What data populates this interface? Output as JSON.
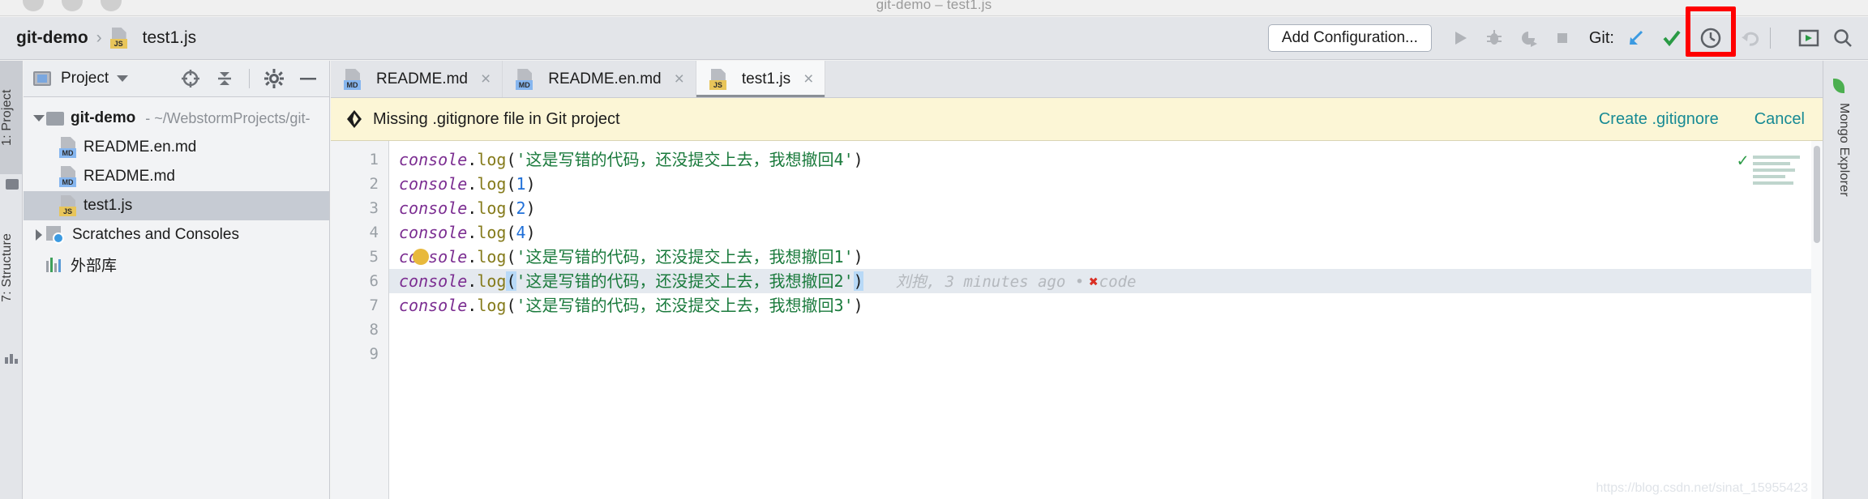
{
  "window": {
    "title": "git-demo – test1.js"
  },
  "breadcrumb": {
    "project": "git-demo",
    "separator": "›",
    "file": "test1.js"
  },
  "toolbar": {
    "add_configuration": "Add Configuration...",
    "git_label": "Git:",
    "icons": [
      "run-icon",
      "debug-icon",
      "run-coverage-icon",
      "stop-icon"
    ],
    "git_icons": [
      "update-project-icon",
      "commit-icon",
      "history-icon",
      "rollback-icon"
    ],
    "right_icons": [
      "terminal-icon",
      "search-everywhere-icon"
    ]
  },
  "left_strip": {
    "tabs": [
      {
        "label": "1: Project",
        "active": true
      },
      {
        "label": "7: Structure",
        "active": false
      }
    ]
  },
  "project_panel": {
    "title": "Project",
    "tools": [
      "locate-icon",
      "collapse-all-icon",
      "settings-gear-icon",
      "hide-icon"
    ],
    "tree": [
      {
        "name": "git-demo",
        "path": "- ~/WebstormProjects/git-",
        "type": "folder",
        "depth": 0,
        "expanded": true,
        "selected": false
      },
      {
        "name": "README.en.md",
        "badge": "MD",
        "type": "file",
        "depth": 1,
        "selected": false
      },
      {
        "name": "README.md",
        "badge": "MD",
        "type": "file",
        "depth": 1,
        "selected": false
      },
      {
        "name": "test1.js",
        "badge": "JS",
        "type": "file",
        "depth": 1,
        "selected": true
      },
      {
        "name": "Scratches and Consoles",
        "type": "scratches",
        "depth": 0,
        "expanded": false,
        "selected": false
      },
      {
        "name": "外部库",
        "type": "library",
        "depth": 0,
        "selected": false
      }
    ]
  },
  "editor": {
    "tabs": [
      {
        "label": "README.md",
        "badge": "MD",
        "active": false,
        "close": "×"
      },
      {
        "label": "README.en.md",
        "badge": "MD",
        "active": false,
        "close": "×"
      },
      {
        "label": "test1.js",
        "badge": "JS",
        "active": true,
        "close": "×"
      }
    ],
    "notification": {
      "icon": "idea-diamond-icon",
      "message": "Missing .gitignore file in Git project",
      "actions": [
        "Create .gitignore",
        "Cancel"
      ]
    },
    "line_numbers": [
      "1",
      "2",
      "3",
      "4",
      "5",
      "6",
      "7",
      "8",
      "9"
    ],
    "lines": [
      {
        "n": 1,
        "obj": "console",
        "dot": ".",
        "fn": "log",
        "open": "(",
        "arg": "'这是写错的代码，还没提交上去，我想撤回4'",
        "argtype": "string",
        "close": ")"
      },
      {
        "n": 2,
        "obj": "console",
        "dot": ".",
        "fn": "log",
        "open": "(",
        "arg": "1",
        "argtype": "number",
        "close": ")"
      },
      {
        "n": 3,
        "obj": "console",
        "dot": ".",
        "fn": "log",
        "open": "(",
        "arg": "2",
        "argtype": "number",
        "close": ")"
      },
      {
        "n": 4,
        "obj": "console",
        "dot": ".",
        "fn": "log",
        "open": "(",
        "arg": "4",
        "argtype": "number",
        "close": ")"
      },
      {
        "n": 5,
        "obj": "console",
        "dot": ".",
        "fn": "log",
        "open": "(",
        "arg": "'这是写错的代码，还没提交上去，我想撤回1'",
        "argtype": "string",
        "close": ")"
      },
      {
        "n": 6,
        "obj": "console",
        "dot": ".",
        "fn": "log",
        "open": "(",
        "arg": "'这是写错的代码，还没提交上去，我想撤回2'",
        "argtype": "string",
        "close": ")"
      },
      {
        "n": 7,
        "obj": "console",
        "dot": ".",
        "fn": "log",
        "open": "(",
        "arg": "'这是写错的代码，还没提交上去，我想撤回3'",
        "argtype": "string",
        "close": ")"
      },
      {
        "n": 8,
        "obj": "",
        "dot": "",
        "fn": "",
        "open": "",
        "arg": "",
        "argtype": "none",
        "close": ""
      },
      {
        "n": 9,
        "obj": "",
        "dot": "",
        "fn": "",
        "open": "",
        "arg": "",
        "argtype": "none",
        "close": ""
      }
    ],
    "blame": {
      "line": 6,
      "author": "刘抱",
      "time": "3 minutes ago",
      "bullet": "•",
      "mark": "✖",
      "message": "code"
    },
    "watermark": "https://blog.csdn.net/sinat_15955423"
  },
  "right_strip": {
    "tabs": [
      {
        "label": "Mongo Explorer",
        "icon": "mongo-leaf-icon"
      }
    ]
  },
  "colors": {
    "toolbar_bg": "#e3e5e9",
    "notification_bg": "#fcf6d6",
    "link": "#178a94",
    "highlight_box": "#ff0000",
    "string": "#1a7a3c",
    "number": "#1f6fd8",
    "keyword": "#7b2d91",
    "function": "#857b1b",
    "selection": "#c6cbd3"
  }
}
